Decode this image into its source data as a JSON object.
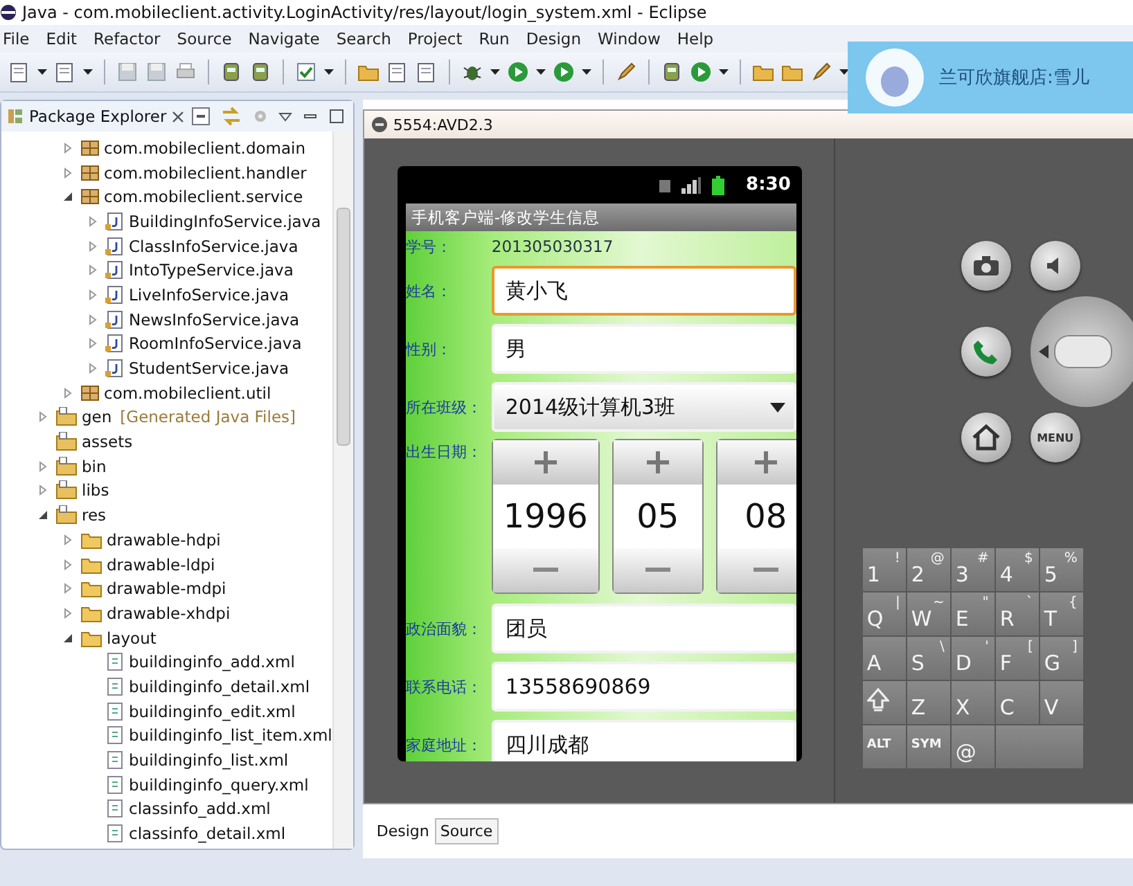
{
  "window": {
    "title": "Java - com.mobileclient.activity.LoginActivity/res/layout/login_system.xml - Eclipse"
  },
  "menu": [
    "File",
    "Edit",
    "Refactor",
    "Source",
    "Navigate",
    "Search",
    "Project",
    "Run",
    "Design",
    "Window",
    "Help"
  ],
  "explorer": {
    "tab": "Package Explorer",
    "tree_continued": [
      {
        "label": "com.mobileclient.domain",
        "kind": "package",
        "expanded": false
      },
      {
        "label": "com.mobileclient.handler",
        "kind": "package",
        "expanded": false
      },
      {
        "label": "com.mobileclient.service",
        "kind": "package",
        "expanded": true,
        "children": [
          {
            "label": "BuildingInfoService.java",
            "kind": "java",
            "expanded": false
          },
          {
            "label": "ClassInfoService.java",
            "kind": "java",
            "expanded": false
          },
          {
            "label": "IntoTypeService.java",
            "kind": "java",
            "expanded": false
          },
          {
            "label": "LiveInfoService.java",
            "kind": "java",
            "expanded": false
          },
          {
            "label": "NewsInfoService.java",
            "kind": "java",
            "expanded": false
          },
          {
            "label": "RoomInfoService.java",
            "kind": "java",
            "expanded": false
          },
          {
            "label": "StudentService.java",
            "kind": "java",
            "expanded": false
          }
        ]
      },
      {
        "label": "com.mobileclient.util",
        "kind": "package",
        "expanded": false
      }
    ],
    "tree": [
      {
        "label": "gen",
        "decoration": "[Generated Java Files]",
        "kind": "source-folder",
        "expanded": false
      },
      {
        "label": "assets",
        "kind": "source-folder"
      },
      {
        "label": "bin",
        "kind": "source-folder",
        "expanded": false
      },
      {
        "label": "libs",
        "kind": "source-folder",
        "expanded": false
      },
      {
        "label": "res",
        "kind": "source-folder",
        "expanded": true,
        "children": [
          {
            "label": "drawable-hdpi",
            "kind": "folder",
            "expanded": false
          },
          {
            "label": "drawable-ldpi",
            "kind": "folder",
            "expanded": false
          },
          {
            "label": "drawable-mdpi",
            "kind": "folder",
            "expanded": false
          },
          {
            "label": "drawable-xhdpi",
            "kind": "folder",
            "expanded": false
          },
          {
            "label": "layout",
            "kind": "folder",
            "expanded": true,
            "children": [
              {
                "label": "buildinginfo_add.xml",
                "kind": "xml"
              },
              {
                "label": "buildinginfo_detail.xml",
                "kind": "xml"
              },
              {
                "label": "buildinginfo_edit.xml",
                "kind": "xml"
              },
              {
                "label": "buildinginfo_list_item.xml",
                "kind": "xml"
              },
              {
                "label": "buildinginfo_list.xml",
                "kind": "xml"
              },
              {
                "label": "buildinginfo_query.xml",
                "kind": "xml"
              },
              {
                "label": "classinfo_add.xml",
                "kind": "xml"
              },
              {
                "label": "classinfo_detail.xml",
                "kind": "xml"
              }
            ]
          }
        ]
      }
    ]
  },
  "emulator": {
    "title": "5554:AVD2.3",
    "clock": "8:30",
    "app_title": "手机客户端-修改学生信息",
    "fields": [
      {
        "label": "学号：",
        "kind": "static",
        "value": "201305030317"
      },
      {
        "label": "姓名：",
        "kind": "input",
        "value": "黄小飞",
        "focused": true
      },
      {
        "label": "性别：",
        "kind": "input",
        "value": "男",
        "focused": false
      },
      {
        "label": "所在班级：",
        "kind": "spinner",
        "value": "2014级计算机3班"
      },
      {
        "label": "出生日期：",
        "kind": "date",
        "parts": [
          "1996",
          "05",
          "08"
        ]
      },
      {
        "label": "政治面貌：",
        "kind": "input",
        "value": "团员",
        "focused": false
      },
      {
        "label": "联系电话：",
        "kind": "input",
        "value": "13558690869",
        "focused": false
      },
      {
        "label": "家庭地址：",
        "kind": "input",
        "value": "四川成都",
        "focused": false
      }
    ],
    "menu_key": "MENU",
    "keyboard": [
      [
        {
          "kind": "char",
          "main": "1",
          "alt": "!"
        },
        {
          "kind": "char",
          "main": "2",
          "alt": "@"
        },
        {
          "kind": "char",
          "main": "3",
          "alt": "#"
        },
        {
          "kind": "char",
          "main": "4",
          "alt": "$"
        },
        {
          "kind": "char",
          "main": "5",
          "alt": "%"
        }
      ],
      [
        {
          "kind": "char",
          "main": "Q",
          "alt": "|"
        },
        {
          "kind": "char",
          "main": "W",
          "alt": "~"
        },
        {
          "kind": "char",
          "main": "E",
          "alt": "\""
        },
        {
          "kind": "char",
          "main": "R",
          "alt": "`"
        },
        {
          "kind": "char",
          "main": "T",
          "alt": "{"
        }
      ],
      [
        {
          "kind": "char",
          "main": "A"
        },
        {
          "kind": "char",
          "main": "S",
          "alt": "\\"
        },
        {
          "kind": "char",
          "main": "D",
          "alt": "'"
        },
        {
          "kind": "char",
          "main": "F",
          "alt": "["
        },
        {
          "kind": "char",
          "main": "G",
          "alt": "]"
        }
      ],
      [
        {
          "kind": "shift"
        },
        {
          "kind": "char",
          "main": "Z"
        },
        {
          "kind": "char",
          "main": "X"
        },
        {
          "kind": "char",
          "main": "C"
        },
        {
          "kind": "char",
          "main": "V"
        }
      ],
      [
        {
          "kind": "label",
          "main": "ALT"
        },
        {
          "kind": "label",
          "main": "SYM"
        },
        {
          "kind": "char",
          "main": "@"
        },
        {
          "kind": "blank"
        }
      ]
    ]
  },
  "editor_tabs": [
    {
      "label": "Design",
      "selected": true
    },
    {
      "label": "Source",
      "selected": false
    }
  ],
  "notification": {
    "title": "兰可欣旗舰店:雪儿"
  }
}
